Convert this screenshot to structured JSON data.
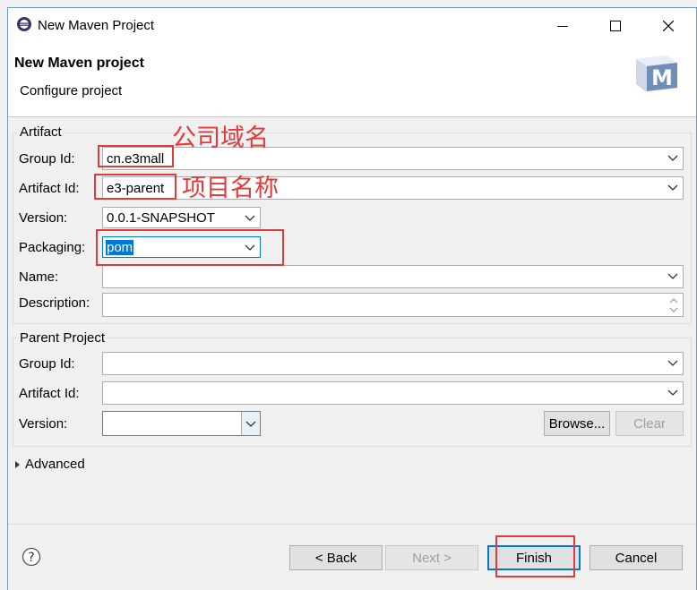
{
  "window": {
    "title": "New Maven Project"
  },
  "header": {
    "title": "New Maven project",
    "subtitle": "Configure project"
  },
  "artifact": {
    "group_title": "Artifact",
    "group_id_label": "Group Id:",
    "group_id_value": "cn.e3mall",
    "artifact_id_label": "Artifact Id:",
    "artifact_id_value": "e3-parent",
    "version_label": "Version:",
    "version_value": "0.0.1-SNAPSHOT",
    "packaging_label": "Packaging:",
    "packaging_value": "pom",
    "name_label": "Name:",
    "name_value": "",
    "description_label": "Description:",
    "description_value": ""
  },
  "parent": {
    "group_title": "Parent Project",
    "group_id_label": "Group Id:",
    "artifact_id_label": "Artifact Id:",
    "version_label": "Version:",
    "browse_label": "Browse...",
    "clear_label": "Clear"
  },
  "advanced": {
    "label": "Advanced"
  },
  "footer": {
    "back_label": "< Back",
    "next_label": "Next >",
    "finish_label": "Finish",
    "cancel_label": "Cancel"
  },
  "annotations": {
    "company_domain": "公司域名",
    "project_name": "项目名称"
  },
  "icons": [
    "eclipse-app-icon",
    "minimize-icon",
    "maximize-icon",
    "close-icon",
    "maven-logo-icon",
    "chevron-down-icon",
    "spinner-icon",
    "expand-triangle-icon",
    "help-icon"
  ],
  "colors": {
    "annotation_red": "#e03a3a",
    "selection_blue": "#0078d7",
    "focus_border": "#0078d7"
  }
}
